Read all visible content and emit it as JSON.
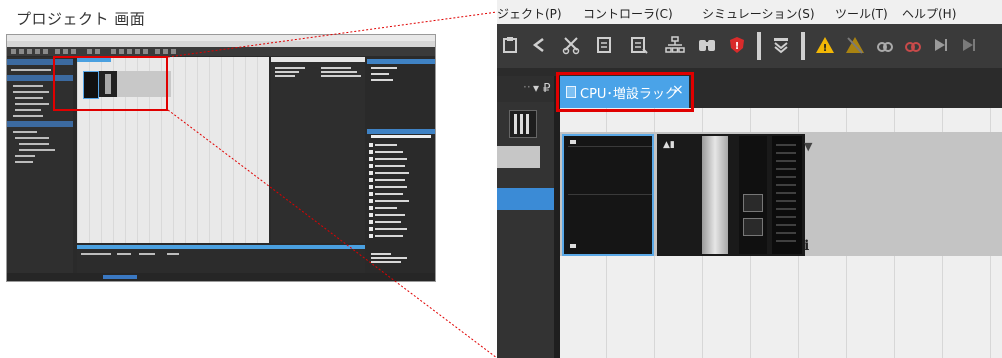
{
  "caption": "プロジェクト 画面",
  "zoom": {
    "menu_items": [
      "ジェクト(P)",
      "コントローラ(C)",
      "シミュレーション(S)",
      "ツール(T)",
      "ヘルプ(H)"
    ],
    "toolbar_icons": [
      "paste-icon",
      "undo-icon",
      "cut-icon",
      "copy-icon",
      "copy-icon-2",
      "network-icon",
      "binoculars-icon",
      "error-shield-icon",
      "compare-icon",
      "warning-icon",
      "warning-off-icon",
      "link-icon",
      "link-red-icon",
      "step-icon"
    ],
    "left_header": "▾ ₽",
    "tab": {
      "label": "CPU･増設ラック",
      "close": "×"
    },
    "canvas": {
      "arrow": "▼",
      "info": "i"
    },
    "highlight_color": "#e00000",
    "accent_color": "#4aa3e8"
  }
}
